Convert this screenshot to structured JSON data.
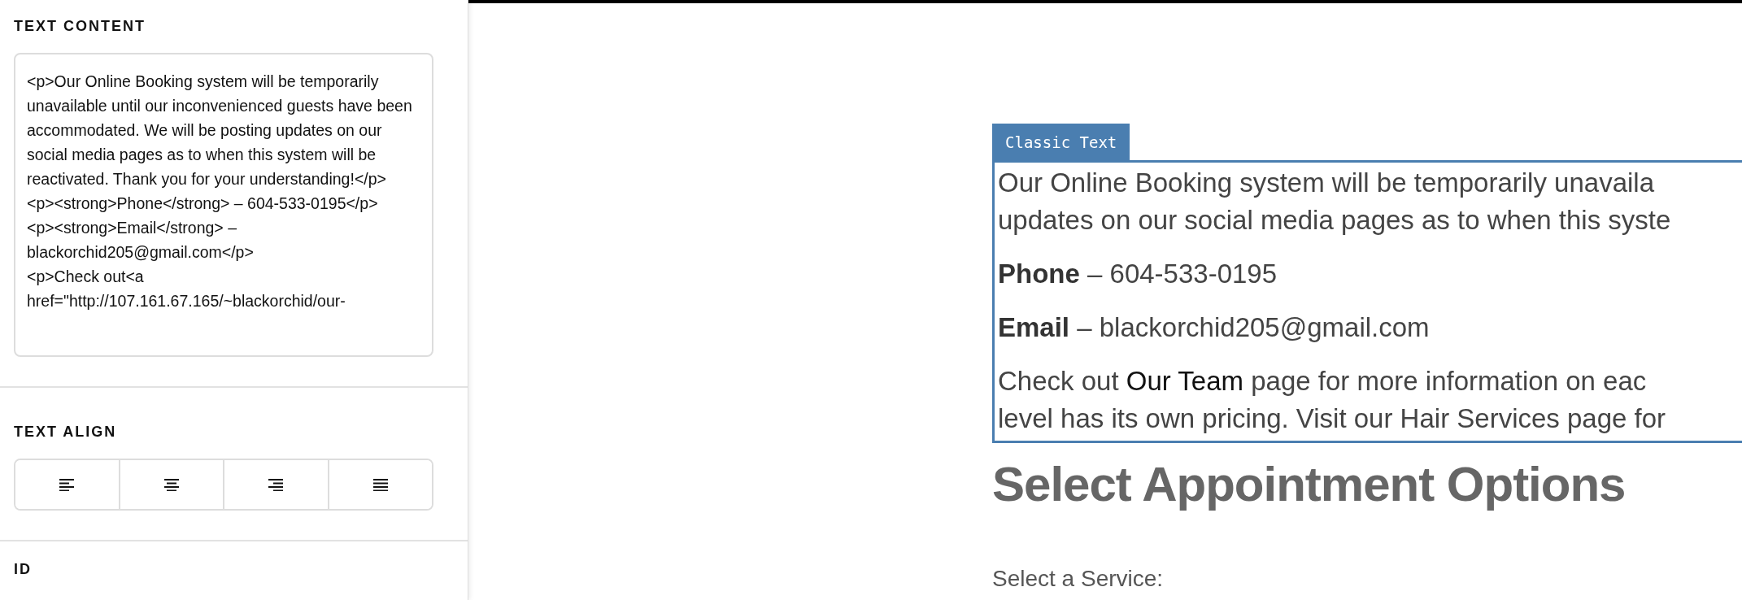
{
  "sidebar": {
    "text_content": {
      "label": "TEXT CONTENT",
      "value": "<p>Our Online Booking system will be temporarily unavailable until our inconvenienced guests have been accommodated. We will be posting updates on our social media pages as to when this system will be reactivated. Thank you for your understanding!</p>\n<p><strong>Phone</strong> – 604-533-0195</p>\n<p><strong>Email</strong> – blackorchid205@gmail.com</p>\n<p>Check out<a href=\"http://107.161.67.165/~blackorchid/our-"
    },
    "text_align": {
      "label": "TEXT ALIGN",
      "options": [
        {
          "kind": "left"
        },
        {
          "kind": "center"
        },
        {
          "kind": "right"
        },
        {
          "kind": "justify"
        }
      ]
    },
    "id": {
      "label": "ID"
    }
  },
  "canvas": {
    "block_tag": "Classic Text",
    "paragraphs": [
      {
        "lines": [
          "Our Online Booking system will be temporarily unavaila",
          "updates on our social media pages as to when this syste"
        ]
      },
      {
        "lines": [
          "**Phone** – 604-533-0195"
        ]
      },
      {
        "lines": [
          "**Email** – blackorchid205@gmail.com"
        ]
      },
      {
        "lines": [
          "level has its own pricing. Visit our Hair Services page for"
        ],
        "link_line": {
          "before": "Check out",
          "link": "Our Team",
          "after": "page for more information on eac"
        }
      }
    ],
    "heading": "Select Appointment Options",
    "service_label": "Select a Service:"
  }
}
